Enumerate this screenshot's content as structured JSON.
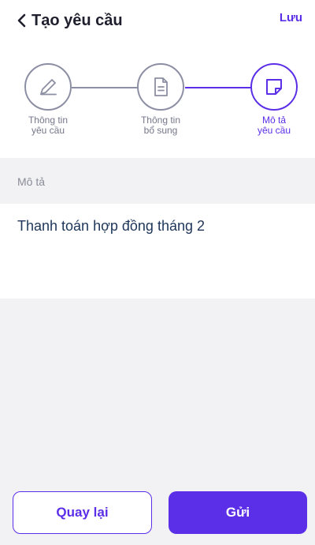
{
  "header": {
    "title": "Tạo yêu cầu",
    "save_label": "Lưu"
  },
  "stepper": {
    "steps": [
      {
        "label_line1": "Thông tin",
        "label_line2": "yêu cầu",
        "icon": "pencil-icon",
        "active": false
      },
      {
        "label_line1": "Thông tin",
        "label_line2": "bổ sung",
        "icon": "document-icon",
        "active": false
      },
      {
        "label_line1": "Mô tả",
        "label_line2": "yêu cầu",
        "icon": "note-icon",
        "active": true
      }
    ]
  },
  "description": {
    "label": "Mô tả",
    "value": "Thanh toán hợp đồng tháng 2"
  },
  "footer": {
    "back_label": "Quay lại",
    "send_label": "Gửi"
  },
  "colors": {
    "accent": "#5b2ee8",
    "inactive": "#8c8ea3",
    "background": "#f2f2f4"
  }
}
